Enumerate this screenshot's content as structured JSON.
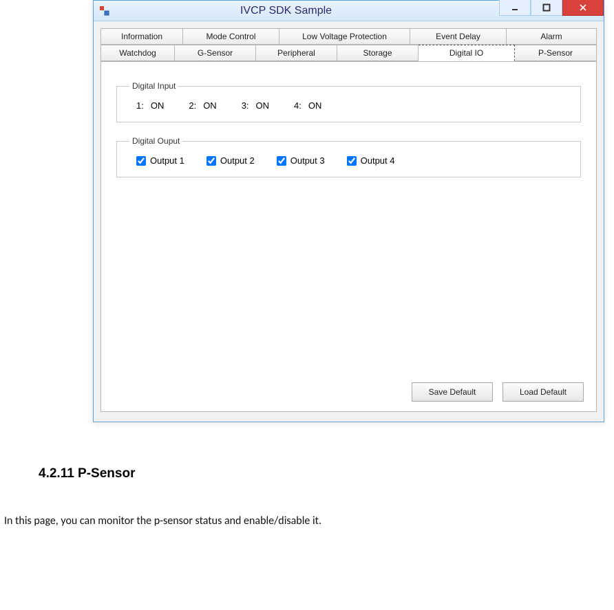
{
  "window": {
    "title": "IVCP SDK Sample"
  },
  "tabs": {
    "row1": [
      {
        "label": "Information"
      },
      {
        "label": "Mode Control"
      },
      {
        "label": "Low Voltage Protection"
      },
      {
        "label": "Event Delay"
      },
      {
        "label": "Alarm"
      }
    ],
    "row2": [
      {
        "label": "Watchdog"
      },
      {
        "label": "G-Sensor"
      },
      {
        "label": "Peripheral"
      },
      {
        "label": "Storage"
      },
      {
        "label": "Digital IO"
      },
      {
        "label": "P-Sensor"
      }
    ],
    "selected": "Digital IO"
  },
  "digital_input": {
    "legend": "Digital Input",
    "items": [
      {
        "idx": "1:",
        "val": "ON"
      },
      {
        "idx": "2:",
        "val": "ON"
      },
      {
        "idx": "3:",
        "val": "ON"
      },
      {
        "idx": "4:",
        "val": "ON"
      }
    ]
  },
  "digital_output": {
    "legend": "Digital Ouput",
    "items": [
      {
        "label": "Output 1",
        "checked": true
      },
      {
        "label": "Output 2",
        "checked": true
      },
      {
        "label": "Output 3",
        "checked": true
      },
      {
        "label": "Output 4",
        "checked": true
      }
    ]
  },
  "buttons": {
    "save_default": "Save Default",
    "load_default": "Load Default"
  },
  "doc": {
    "heading": "4.2.11 P-Sensor",
    "body": "In this page, you can monitor the p-sensor status and enable/disable it."
  }
}
